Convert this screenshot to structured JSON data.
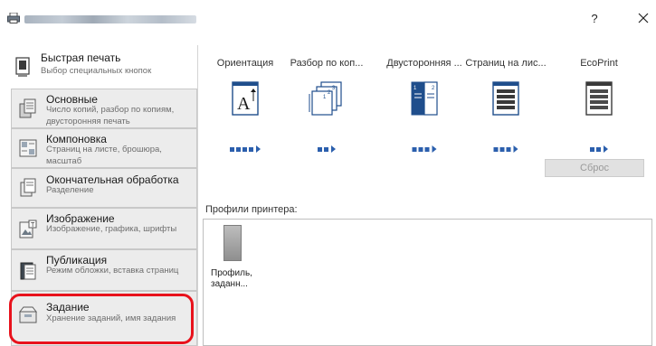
{
  "window": {
    "help_label": "?",
    "close_label": "✕"
  },
  "sidebar": {
    "items": [
      {
        "title": "Быстрая печать",
        "subtitle": "Выбор специальных кнопок",
        "icon": "quick-print-icon"
      },
      {
        "title": "Основные",
        "subtitle": "Число копий, разбор по копиям, двусторонняя печать",
        "icon": "basic-icon"
      },
      {
        "title": "Компоновка",
        "subtitle": "Страниц на листе, брошюра, масштаб",
        "icon": "layout-icon"
      },
      {
        "title": "Окончательная обработка",
        "subtitle": "Разделение",
        "icon": "finishing-icon"
      },
      {
        "title": "Изображение",
        "subtitle": "Изображение, графика, шрифты",
        "icon": "image-icon"
      },
      {
        "title": "Публикация",
        "subtitle": "Режим обложки, вставка страниц",
        "icon": "publishing-icon"
      },
      {
        "title": "Задание",
        "subtitle": "Хранение заданий, имя задания",
        "icon": "job-icon"
      }
    ],
    "active_index": 0,
    "highlighted_index": 6,
    "highlight_color": "#e8121c"
  },
  "quick_print": {
    "tiles": [
      {
        "label": "Ориентация",
        "icon": "orientation-icon",
        "dots": 4
      },
      {
        "label": "Разбор по коп...",
        "icon": "collate-icon",
        "dots": 2
      },
      {
        "label": "Двусторонняя ...",
        "icon": "duplex-icon",
        "dots": 3
      },
      {
        "label": "Страниц на лис...",
        "icon": "pages-per-sheet-icon",
        "dots": 3
      },
      {
        "label": "EcoPrint",
        "icon": "ecoprint-icon",
        "dots": 2
      }
    ],
    "accent_color": "#2b5fad",
    "reset_label": "Сброс"
  },
  "profiles": {
    "label": "Профили принтера:",
    "items": [
      {
        "name": "Профиль, заданн..."
      }
    ]
  }
}
